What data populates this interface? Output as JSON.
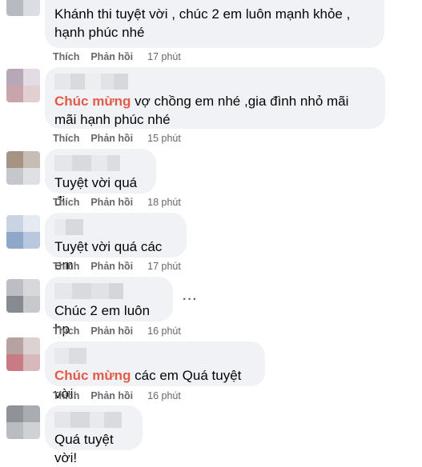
{
  "comments": [
    {
      "text_plain": "Khánh thi tuyệt vời , chúc 2 em luôn mạnh khỏe , hạnh phúc nhé",
      "like": "Thích",
      "reply": "Phản hồi",
      "time": "17 phút"
    },
    {
      "highlight": "Chúc mừng",
      "text_rest": " vợ chồng em nhé ,gia đình nhỏ mãi mãi hạnh phúc nhé",
      "like": "Thích",
      "reply": "Phản hồi",
      "time": "15 phút"
    },
    {
      "text_plain": "Tuyệt vời quá đi",
      "like": "Thích",
      "reply": "Phản hồi",
      "time": "18 phút"
    },
    {
      "text_plain": "Tuyệt vời quá các em",
      "like": "Thích",
      "reply": "Phản hồi",
      "time": "17 phút"
    },
    {
      "text_plain": "Chúc 2 em luôn hp",
      "more": "···",
      "like": "Thích",
      "reply": "Phản hồi",
      "time": "16 phút"
    },
    {
      "highlight": "Chúc mừng",
      "text_rest": " các em Quá tuyệt vời.",
      "like": "Thích",
      "reply": "Phản hồi",
      "time": "16 phút"
    },
    {
      "text_plain": "Quá tuyệt vời!"
    }
  ],
  "colors": {
    "bubble": "#f0f2f5",
    "highlight": "#e35a47",
    "meta": "#65676b"
  },
  "icons": [
    "more-icon"
  ]
}
